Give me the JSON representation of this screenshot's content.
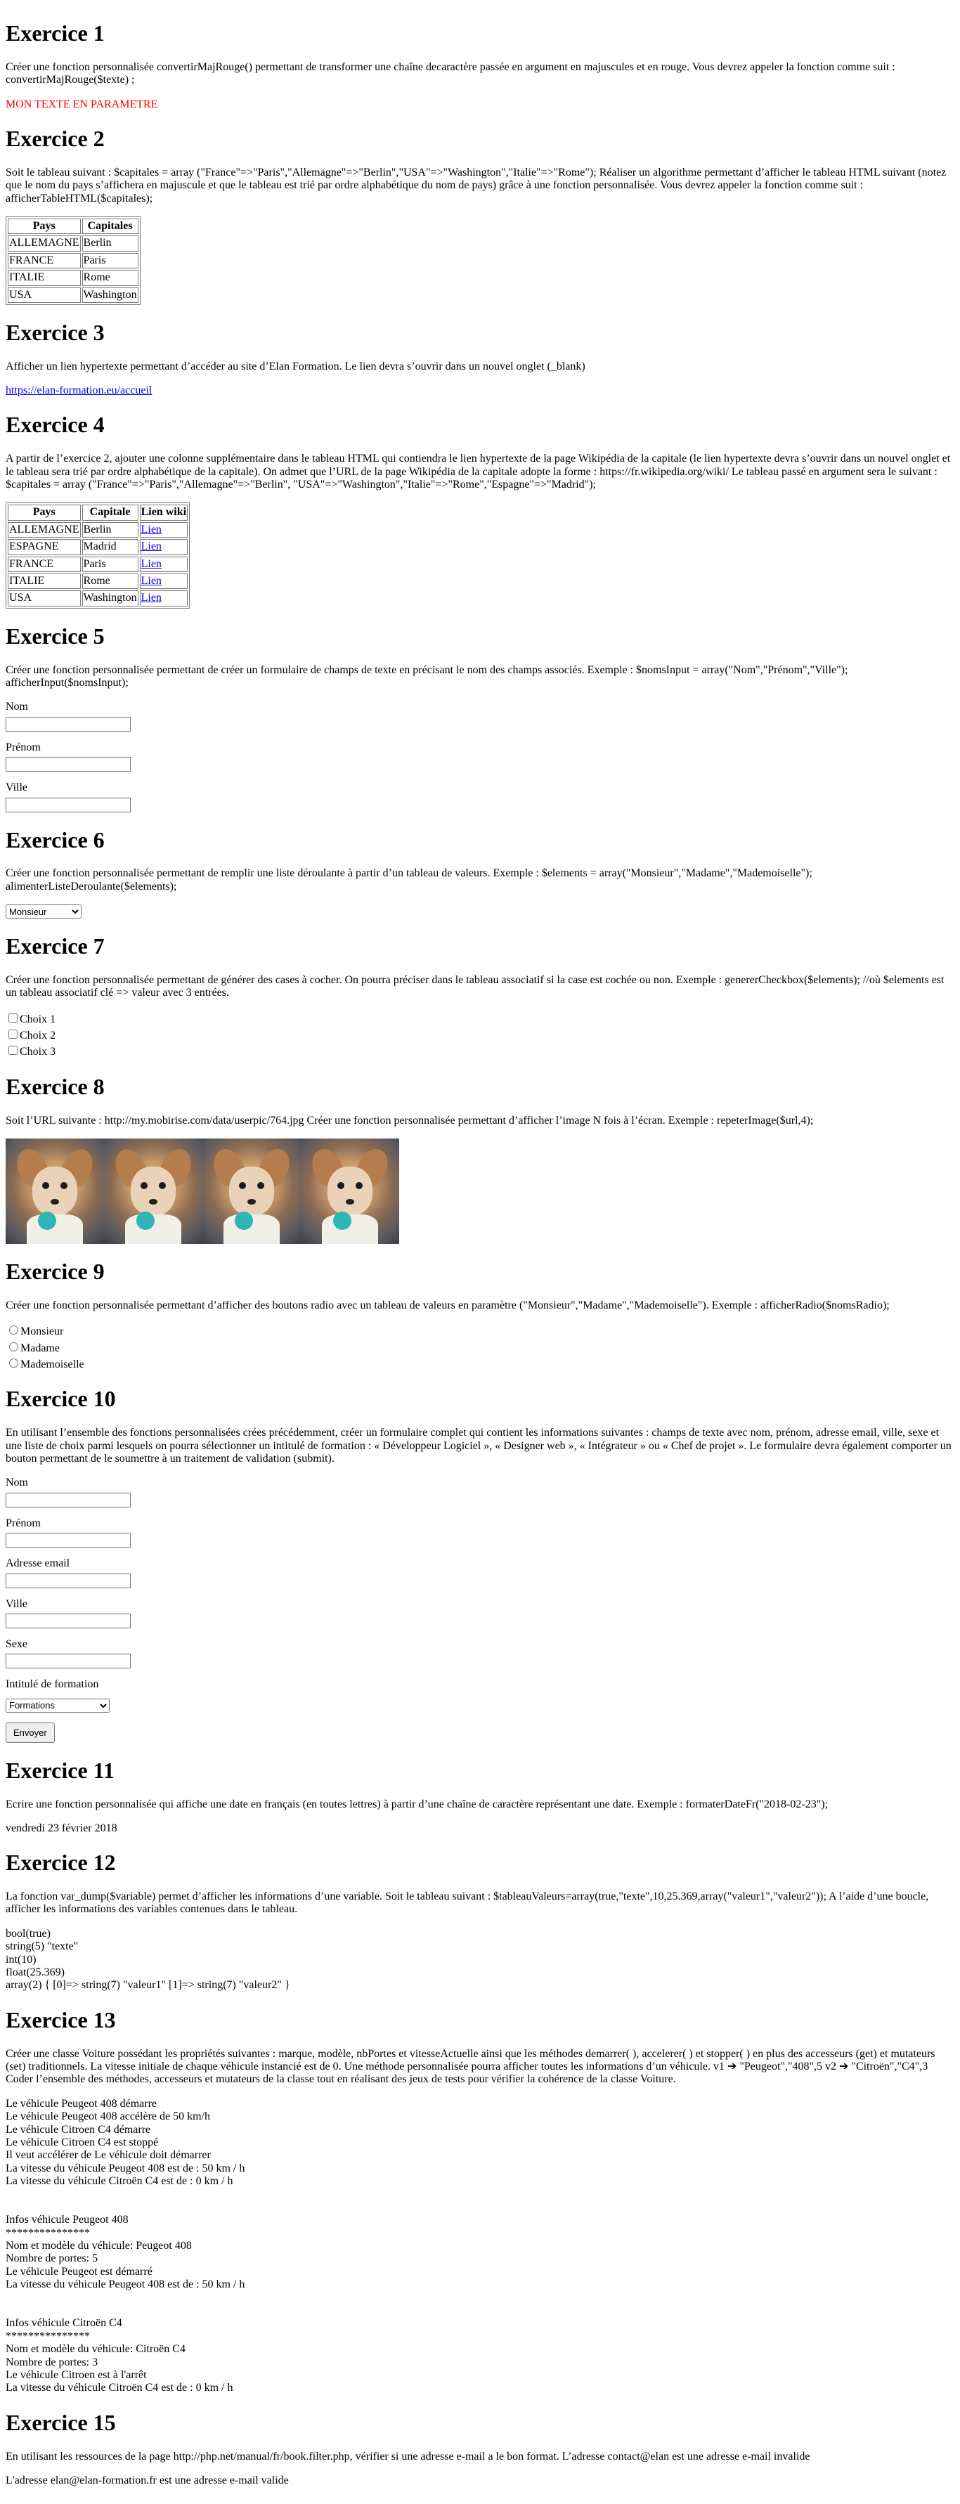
{
  "ex1": {
    "title": "Exercice 1",
    "desc": "Créer une fonction personnalisée convertirMajRouge() permettant de transformer une chaîne decaractère passée en argument en majuscules et en rouge. Vous devrez appeler la fonction comme suit : convertirMajRouge($texte) ;",
    "result": "MON TEXTE EN PARAMETRE",
    "result_color": "#ff0000"
  },
  "ex2": {
    "title": "Exercice 2",
    "desc": "Soit le tableau suivant : $capitales = array (\"France\"=>\"Paris\",\"Allemagne\"=>\"Berlin\",\"USA\"=>\"Washington\",\"Italie\"=>\"Rome\"); Réaliser un algorithme permettant d’afficher le tableau HTML suivant (notez que le nom du pays s’affichera en majuscule et que le tableau est trié par ordre alphabétique du nom de pays) grâce à une fonction personnalisée. Vous devrez appeler la fonction comme suit : afficherTableHTML($capitales);",
    "headers": [
      "Pays",
      "Capitales"
    ],
    "rows": [
      [
        "ALLEMAGNE",
        "Berlin"
      ],
      [
        "FRANCE",
        "Paris"
      ],
      [
        "ITALIE",
        "Rome"
      ],
      [
        "USA",
        "Washington"
      ]
    ]
  },
  "ex3": {
    "title": "Exercice 3",
    "desc": "Afficher un lien hypertexte permettant d’accéder au site d’Elan Formation. Le lien devra s’ouvrir dans un nouvel onglet (_blank)",
    "link": "https://elan-formation.eu/accueil"
  },
  "ex4": {
    "title": "Exercice 4",
    "desc": "A partir de l’exercice 2, ajouter une colonne supplémentaire dans le tableau HTML qui contiendra le lien hypertexte de la page Wikipédia de la capitale (le lien hypertexte devra s’ouvrir dans un nouvel onglet et le tableau sera trié par ordre alphabétique de la capitale). On admet que l’URL de la page Wikipédia de la capitale adopte la forme : https://fr.wikipedia.org/wiki/ Le tableau passé en argument sera le suivant : $capitales = array (\"France\"=>\"Paris\",\"Allemagne\"=>\"Berlin\", \"USA\"=>\"Washington\",\"Italie\"=>\"Rome\",\"Espagne\"=>\"Madrid\");",
    "headers": [
      "Pays",
      "Capitale",
      "Lien wiki"
    ],
    "rows": [
      [
        "ALLEMAGNE",
        "Berlin",
        "Lien"
      ],
      [
        "ESPAGNE",
        "Madrid",
        "Lien"
      ],
      [
        "FRANCE",
        "Paris",
        "Lien"
      ],
      [
        "ITALIE",
        "Rome",
        "Lien"
      ],
      [
        "USA",
        "Washington",
        "Lien"
      ]
    ]
  },
  "ex5": {
    "title": "Exercice 5",
    "desc": "Créer une fonction personnalisée permettant de créer un formulaire de champs de texte en précisant le nom des champs associés. Exemple : $nomsInput = array(\"Nom\",\"Prénom\",\"Ville\"); afficherInput($nomsInput);",
    "fields": [
      "Nom",
      "Prénom",
      "Ville"
    ]
  },
  "ex6": {
    "title": "Exercice 6",
    "desc": "Créer une fonction personnalisée permettant de remplir une liste déroulante à partir d’un tableau de valeurs. Exemple : $elements = array(\"Monsieur\",\"Madame\",\"Mademoiselle\"); alimenterListeDeroulante($elements);",
    "selected": "Monsieur"
  },
  "ex7": {
    "title": "Exercice 7",
    "desc": "Créer une fonction personnalisée permettant de générer des cases à cocher. On pourra préciser dans le tableau associatif si la case est cochée ou non. Exemple : genererCheckbox($elements); //où $elements est un tableau associatif clé => valeur avec 3 entrées.",
    "choices": [
      "Choix 1",
      "Choix 2",
      "Choix 3"
    ]
  },
  "ex8": {
    "title": "Exercice 8",
    "desc": "Soit l’URL suivante : http://my.mobirise.com/data/userpic/764.jpg Créer une fonction personnalisée permettant d’afficher l’image N fois à l’écran. Exemple : repeterImage($url,4);"
  },
  "ex9": {
    "title": "Exercice 9",
    "desc": "Créer une fonction personnalisée permettant d’afficher des boutons radio avec un tableau de valeurs en paramètre (\"Monsieur\",\"Madame\",\"Mademoiselle\"). Exemple : afficherRadio($nomsRadio);",
    "options": [
      "Monsieur",
      "Madame",
      "Mademoiselle"
    ]
  },
  "ex10": {
    "title": "Exercice 10",
    "desc": "En utilisant l’ensemble des fonctions personnalisées crées précédemment, créer un formulaire complet qui contient les informations suivantes : champs de texte avec nom, prénom, adresse email, ville, sexe et une liste de choix parmi lesquels on pourra sélectionner un intitulé de formation : « Développeur Logiciel », « Designer web », « Intégrateur » ou « Chef de projet ». Le formulaire devra également comporter un bouton permettant de le soumettre à un traitement de validation (submit).",
    "fields": [
      "Nom",
      "Prénom",
      "Adresse email",
      "Ville",
      "Sexe"
    ],
    "formation_label": "Intitulé de formation",
    "formation_selected": "Formations",
    "submit": "Envoyer"
  },
  "ex11": {
    "title": "Exercice 11",
    "desc": "Ecrire une fonction personnalisée qui affiche une date en français (en toutes lettres) à partir d’une chaîne de caractère représentant une date. Exemple : formaterDateFr(\"2018-02-23\");",
    "result": "vendredi 23 février 2018"
  },
  "ex12": {
    "title": "Exercice 12",
    "desc": "La fonction var_dump($variable) permet d’afficher les informations d’une variable. Soit le tableau suivant : $tableauValeurs=array(true,\"texte\",10,25.369,array(\"valeur1\",\"valeur2\")); A l’aide d’une boucle, afficher les informations des variables contenues dans le tableau.",
    "lines": [
      "bool(true)",
      "string(5) \"texte\"",
      "int(10)",
      "float(25.369)",
      "array(2) { [0]=> string(7) \"valeur1\" [1]=> string(7) \"valeur2\" }"
    ]
  },
  "ex13": {
    "title": "Exercice 13",
    "desc": "Créer une classe Voiture possédant les propriétés suivantes : marque, modèle, nbPortes et vitesseActuelle ainsi que les méthodes demarrer( ), accelerer( ) et stopper( ) en plus des accesseurs (get) et mutateurs (set) traditionnels. La vitesse initiale de chaque véhicule instancié est de 0. Une méthode personnalisée pourra afficher toutes les informations d’un véhicule. v1 ➔ \"Peugeot\",\"408\",5 v2 ➔ \"Citroën\",\"C4\",3 Coder l’ensemble des méthodes, accesseurs et mutateurs de la classe tout en réalisant des jeux de tests pour vérifier la cohérence de la classe Voiture.",
    "log": [
      "Le véhicule Peugeot 408 démarre",
      "Le véhicule Peugeot 408 accélère de 50 km/h",
      "Le véhicule Citroen C4 démarre",
      "Le véhicule Citroen C4 est stoppé",
      "Il veut accélérer de Le véhicule doit démarrer",
      "La vitesse du véhicule Peugeot 408 est de : 50 km / h",
      "La vitesse du véhicule Citroën C4 est de : 0 km / h"
    ],
    "info1": [
      "Infos véhicule Peugeot 408",
      "***************",
      "Nom et modèle du véhicule: Peugeot 408",
      "Nombre de portes: 5",
      "Le véhicule Peugeot est démarré",
      "La vitesse du véhicule Peugeot 408 est de : 50 km / h"
    ],
    "info2": [
      "Infos véhicule Citroën C4",
      "***************",
      "Nom et modèle du véhicule: Citroën C4",
      "Nombre de portes: 3",
      "Le véhicule Citroen est à l'arrêt",
      "La vitesse du véhicule Citroën C4 est de : 0 km / h"
    ]
  },
  "ex15": {
    "title": "Exercice 15",
    "desc": "En utilisant les ressources de la page http://php.net/manual/fr/book.filter.php, vérifier si une adresse e-mail a le bon format. L’adresse contact@elan est une adresse e-mail invalide",
    "result": "L'adresse elan@elan-formation.fr est une adresse e-mail valide"
  }
}
